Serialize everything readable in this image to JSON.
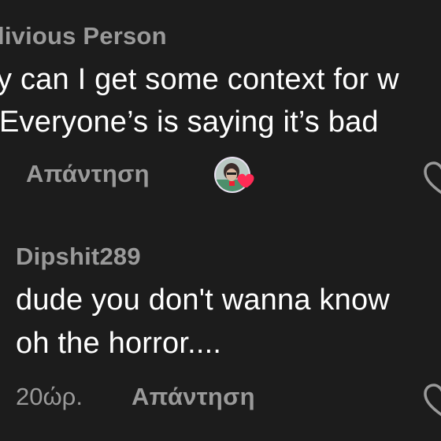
{
  "comments": [
    {
      "username": "livious Person",
      "lines": [
        "y can I get some context for w",
        "Everyone’s is saying it’s bad"
      ],
      "reply_label": "Απάντηση"
    },
    {
      "username": "Dipshit289",
      "lines": [
        "dude you don't wanna know",
        "oh the horror...."
      ],
      "time": "20ώρ.",
      "reply_label": "Απάντηση"
    }
  ],
  "icons": {
    "like": "heart-outline-icon",
    "creator_liked": "creator-liked-avatar-icon"
  },
  "colors": {
    "background": "#1c1c1c",
    "text": "#ffffff",
    "muted": "#9a9a9a",
    "heart_accent": "#ff2b55"
  }
}
